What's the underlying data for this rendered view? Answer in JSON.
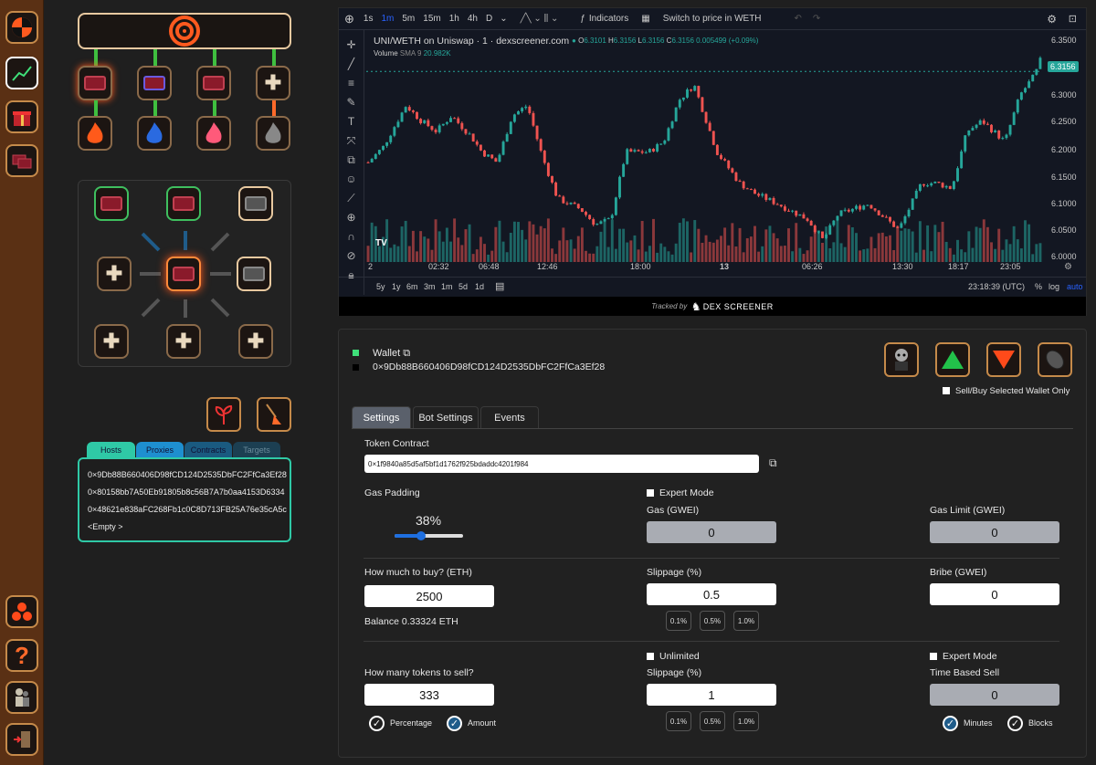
{
  "chart": {
    "timeframes": [
      "1s",
      "1m",
      "5m",
      "15m",
      "1h",
      "4h",
      "D"
    ],
    "indicators_label": "Indicators",
    "switch_label": "Switch to price in WETH",
    "pair_title": "UNI/WETH on Uniswap · 1 · dexscreener.com",
    "ohlc": {
      "o": "6.3101",
      "h": "6.3156",
      "l": "6.3156",
      "c": "6.3156",
      "change": "0.005499 (+0.09%)"
    },
    "volume_label": "Volume",
    "sma_label": "SMA 9",
    "sma_value": "20.982K",
    "y_ticks": [
      "6.3500",
      "6.3000",
      "6.2500",
      "6.2000",
      "6.1500",
      "6.1000",
      "6.0500",
      "6.0000"
    ],
    "last_price": "6.3156",
    "x_ticks": [
      "2",
      "02:32",
      "06:48",
      "12:46",
      "18:00",
      "13",
      "06:26",
      "13:30",
      "18:17",
      "23:05"
    ],
    "ranges": [
      "5y",
      "1y",
      "6m",
      "3m",
      "1m",
      "5d",
      "1d"
    ],
    "time_readout": "23:18:39 (UTC)",
    "pct_label": "%",
    "log_label": "log",
    "auto_label": "auto",
    "tracked_label": "Tracked by",
    "brand": "DEX SCREENER"
  },
  "wallet": {
    "label": "Wallet",
    "address": "0×9Db88B660406D98fCD124D2535DbFC2FfCa3Ef28"
  },
  "selected_only": "Sell/Buy Selected Wallet Only",
  "tabs": [
    "Settings",
    "Bot Settings",
    "Events"
  ],
  "left_tabs": [
    "Hosts",
    "Proxies",
    "Contracts",
    "Targets"
  ],
  "hosts": [
    "0×9Db88B660406D98fCD124D2535DbFC2FfCa3Ef28",
    "0×80158bb7A50Eb91805b8c56B7A7b0aa4153D6334",
    "0×48621e838aFC268Fb1c0C8D713FB25A76e35cA5c",
    "<Empty >"
  ],
  "form": {
    "token_contract_label": "Token Contract",
    "token_contract": "0×1f9840a85d5af5bf1d1762f925bdaddc4201f984",
    "gas_padding_label": "Gas Padding",
    "gas_padding": "38%",
    "gas_padding_value": 0.38,
    "expert_mode": "Expert Mode",
    "gas_label": "Gas (GWEI)",
    "gas": "0",
    "gas_limit_label": "Gas Limit (GWEI)",
    "gas_limit": "0",
    "buy_label": "How much to buy? (ETH)",
    "buy": "2500",
    "slippage_label": "Slippage (%)",
    "slippage_buy": "0.5",
    "bribe_label": "Bribe (GWEI)",
    "bribe": "0",
    "balance": "Balance 0.33324 ETH",
    "chips": [
      "0.1%",
      "0.5%",
      "1.0%"
    ],
    "unlimited": "Unlimited",
    "sell_label": "How many tokens to sell?",
    "sell": "333",
    "slippage_sell": "1",
    "time_sell_label": "Time Based Sell",
    "time_sell": "0",
    "percentage": "Percentage",
    "amount": "Amount",
    "minutes": "Minutes",
    "blocks": "Blocks"
  },
  "colors": {
    "accent": "#1f5c8a",
    "up": "#26a69a",
    "down": "#ef5350",
    "sidebar": "#5a3014"
  }
}
